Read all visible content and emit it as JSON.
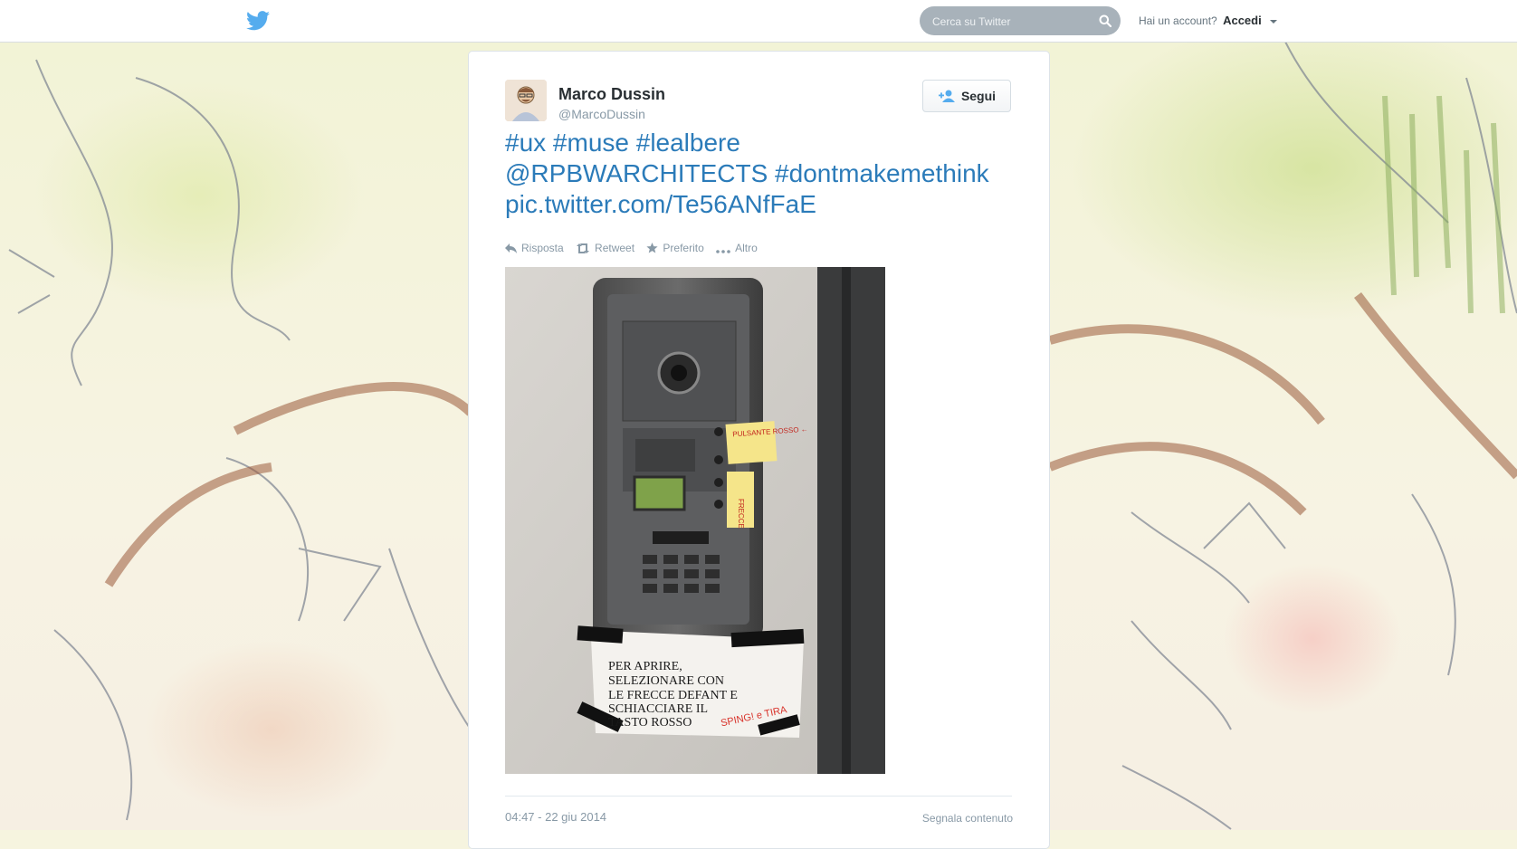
{
  "topbar": {
    "logo_icon": "twitter-bird-icon",
    "search_placeholder": "Cerca su Twitter",
    "search_icon": "search-icon",
    "account_prompt": "Hai un account?",
    "login_label": "Accedi"
  },
  "tweet": {
    "author_name": "Marco Dussin",
    "author_handle": "@MarcoDussin",
    "follow_label": "Segui",
    "text_line1": "#ux #muse #lealbere",
    "text_line2": "@RPBWARCHITECTS #dontmakemethink",
    "text_line3": "pic.twitter.com/Te56ANfFaE",
    "actions": {
      "reply": "Risposta",
      "retweet": "Retweet",
      "favorite": "Preferito",
      "more": "Altro"
    },
    "photo": {
      "sign_line1": "PER APRIRE,",
      "sign_line2": "SELEZIONARE CON",
      "sign_line3": "LE FRECCE DEFANT E",
      "sign_line4": "SCHIACCIARE IL",
      "sign_line5": "TASTO ROSSO",
      "sign_scribble": "SPING! e TIRA",
      "note1": "PULSANTE ROSSO ←",
      "note2": "FRECCE"
    },
    "timestamp": "04:47 - 22 giu 2014",
    "report_label": "Segnala contenuto"
  },
  "colors": {
    "link": "#2b7bb9",
    "muted": "#8899a6",
    "search_bg": "#a8b2ba"
  }
}
